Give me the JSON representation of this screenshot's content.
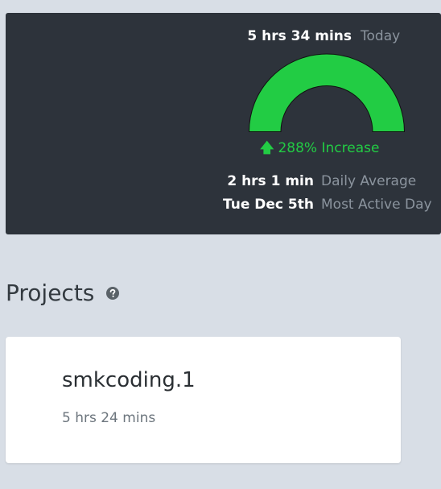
{
  "summary": {
    "today_value": "5 hrs 34 mins",
    "today_label": "Today",
    "gauge_color": "#22cc44",
    "gauge_level_percent": 100,
    "increase_arrow": "🡅",
    "increase_text": "288% Increase",
    "daily_average_value": "2 hrs 1 min",
    "daily_average_label": "Daily Average",
    "most_active_value": "Tue Dec 5th",
    "most_active_label": "Most Active Day"
  },
  "projects": {
    "heading": "Projects",
    "help_icon": "question-circle-icon",
    "items": [
      {
        "name": "smkcoding.1",
        "time": "5 hrs 24 mins"
      }
    ]
  },
  "colors": {
    "panel_bg": "#2d333b",
    "page_bg": "#d8dee6",
    "accent_green": "#22cc44"
  }
}
